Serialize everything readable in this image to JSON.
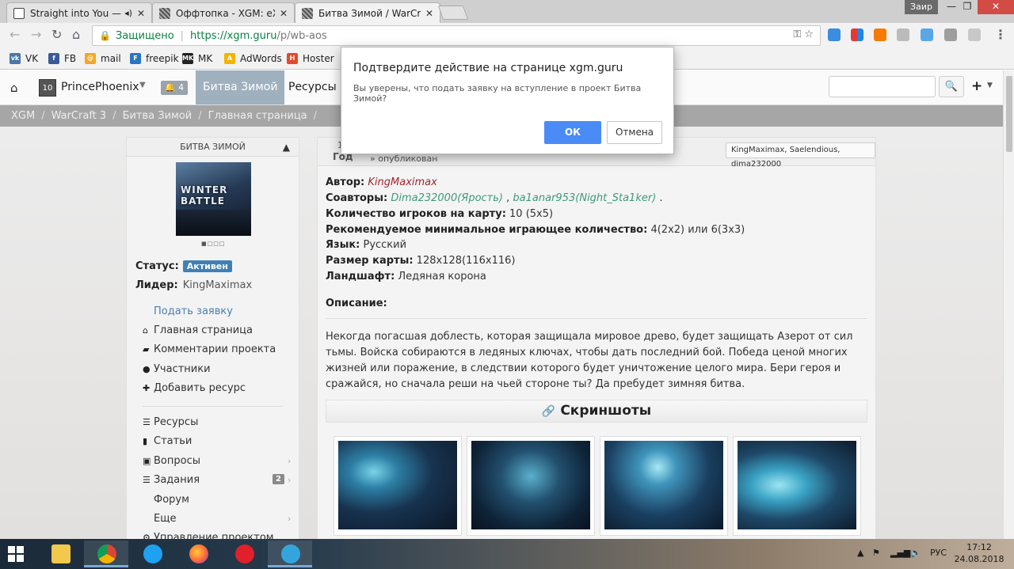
{
  "browser": {
    "tabs": [
      {
        "title": "Straight into You — L",
        "audio_icon": "◂)",
        "close": "✕"
      },
      {
        "title": "Оффтопка - XGM: eXtrem",
        "close": "✕"
      },
      {
        "title": "Битва Зимой / WarCraft",
        "close": "✕"
      }
    ],
    "window_user": "Заир",
    "window_controls": {
      "minimize": "—",
      "maximize": "❐",
      "close": "✕"
    },
    "security_label": "Защищено",
    "url_host": "https://xgm.guru",
    "url_path": "/p/wb-aos",
    "bookmarks": [
      {
        "label": "VK",
        "icon_text": "vk",
        "color": "#4a76a8"
      },
      {
        "label": "FB",
        "icon_text": "f",
        "color": "#3b5998"
      },
      {
        "label": "mail",
        "icon_text": "@",
        "color": "#f5a623"
      },
      {
        "label": "freepik",
        "icon_text": "F",
        "color": "#2a75c4"
      },
      {
        "label": "MK",
        "icon_text": "MK",
        "color": "#222222"
      },
      {
        "label": "AdWords",
        "icon_text": "A",
        "color": "#f4b400"
      },
      {
        "label": "Hoster",
        "icon_text": "H",
        "color": "#e14b2c"
      }
    ]
  },
  "site": {
    "username": "PrincePhoenix",
    "avatar_text": "10",
    "notifications": "4",
    "nav": [
      "Битва Зимой",
      "Ресурсы"
    ],
    "breadcrumbs": [
      "XGM",
      "WarCraft 3",
      "Битва Зимой",
      "Главная страница"
    ],
    "breadcrumb_sep": "/"
  },
  "project": {
    "panel_title": "БИТВА ЗИМОЙ",
    "logo_text": "WINTER BATTLE",
    "status_label": "Статус:",
    "status_value": "Активен",
    "leader_label": "Лидер:",
    "leader_value": "KingMaximax",
    "apply_link": "Подать заявку",
    "menu_a": [
      "Главная страница",
      "Комментарии проекта",
      "Участники",
      "Добавить ресурс"
    ],
    "menu_b": [
      "Ресурсы",
      "Статьи",
      "Вопросы",
      "Задания",
      "Форум",
      "Еще",
      "Управление проектом"
    ],
    "tasks_count": "2"
  },
  "main": {
    "head_year_digit": "1",
    "head_year": "Год",
    "head_published": "» опубликован",
    "head_authors": "KingMaximax, Saelendious, dima232000",
    "author_label": "Автор:",
    "author_value": "KingMaximax",
    "coauthors_label": "Соавторы:",
    "coauthor1": "Dima232000(Ярость)",
    "coauthor2": "ba1anar953(Night_Sta1ker)",
    "coauthor_sep": ",",
    "coauthor_end": ".",
    "players_label": "Количество игроков на карту:",
    "players_value": "10 (5x5)",
    "min_label": "Рекомендуемое минимальное играющее количество:",
    "min_value": "4(2x2) или 6(3x3)",
    "lang_label": "Язык:",
    "lang_value": "Русский",
    "size_label": "Размер карты:",
    "size_value": "128x128(116x116)",
    "land_label": "Ландшафт:",
    "land_value": "Ледяная корона",
    "desc_label": "Описание:",
    "description": "Некогда погасшая доблесть, которая защищала мировое древо, будет защищать Азерот от сил тьмы. Войска собираются в ледяных ключах, чтобы дать последний бой. Победа ценой многих жизней или поражение, в следствии которого будет уничтожение целого мира. Бери героя и сражайся, но сначала реши на чьей стороне ты? Да пребудет зимняя битва.",
    "screens_title": "Скриншоты"
  },
  "dialog": {
    "title": "Подтвердите действие на странице xgm.guru",
    "message": "Вы уверены, что подать заявку на вступление в проект Битва Зимой?",
    "ok": "ОК",
    "cancel": "Отмена"
  },
  "taskbar": {
    "lang": "РУС",
    "time": "17:12",
    "date": "24.08.2018"
  }
}
